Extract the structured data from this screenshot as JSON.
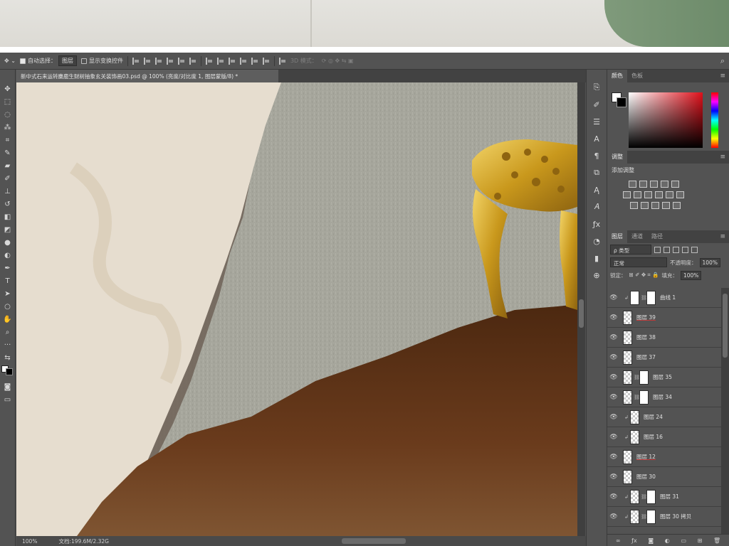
{
  "colors": {
    "ui_bg": "#535353",
    "panel_dark": "#424242",
    "canvas_wall": "#a6a69c",
    "canvas_paper": "#e6ddcf",
    "canvas_hill": "#5e3218",
    "deer_gold": "#d4a92a"
  },
  "options_bar": {
    "move_icon": "move-icon",
    "auto_select_label": "自动选择：",
    "auto_select_value": "图层",
    "show_transform_label": "显示变换控件",
    "mode_3d_label": "3D 模式："
  },
  "document": {
    "tab_title": "新中式石来运转麋鹿生财树抽象玄关装饰画03.psd @ 100% (亮度/对比度 1, 图层蒙版/8) *"
  },
  "status_bar": {
    "zoom": "100%",
    "doc_size": "文档:199.6M/2.32G"
  },
  "toolbar": {
    "tools": [
      "move-icon",
      "marquee-icon",
      "lasso-icon",
      "magic-wand-icon",
      "crop-icon",
      "eyedropper-icon",
      "healing-icon",
      "brush-icon",
      "stamp-icon",
      "history-brush-icon",
      "eraser-icon",
      "gradient-icon",
      "blur-icon",
      "dodge-icon",
      "pen-icon",
      "type-icon",
      "path-select-icon",
      "shape-icon",
      "hand-icon",
      "zoom-icon",
      "more-icon"
    ]
  },
  "color_panel": {
    "tab_color": "颜色",
    "tab_swatches": "色板"
  },
  "adjustments_panel": {
    "tab": "调整",
    "title": "添加调整"
  },
  "layers_panel": {
    "tab_layers": "图层",
    "tab_channels": "通道",
    "tab_paths": "路径",
    "filter_kind": "ρ 类型",
    "blend_mode": "正常",
    "opacity_label": "不透明度：",
    "opacity_value": "100%",
    "lock_label": "锁定：",
    "fill_label": "填充：",
    "fill_value": "100%",
    "layers": [
      {
        "name": "曲线 1",
        "type": "adjustment"
      },
      {
        "name": "图层 39",
        "type": "layer"
      },
      {
        "name": "图层 38",
        "type": "layer"
      },
      {
        "name": "图层 37",
        "type": "layer"
      },
      {
        "name": "图层 35",
        "type": "masked"
      },
      {
        "name": "图层 34",
        "type": "masked"
      },
      {
        "name": "图层 24",
        "type": "clipped"
      },
      {
        "name": "图层 16",
        "type": "clipped"
      },
      {
        "name": "图层 12",
        "type": "layer"
      },
      {
        "name": "图层 30",
        "type": "layer"
      },
      {
        "name": "图层 31",
        "type": "clipped-masked"
      },
      {
        "name": "图层 30 拷贝",
        "type": "clipped-masked"
      }
    ]
  }
}
